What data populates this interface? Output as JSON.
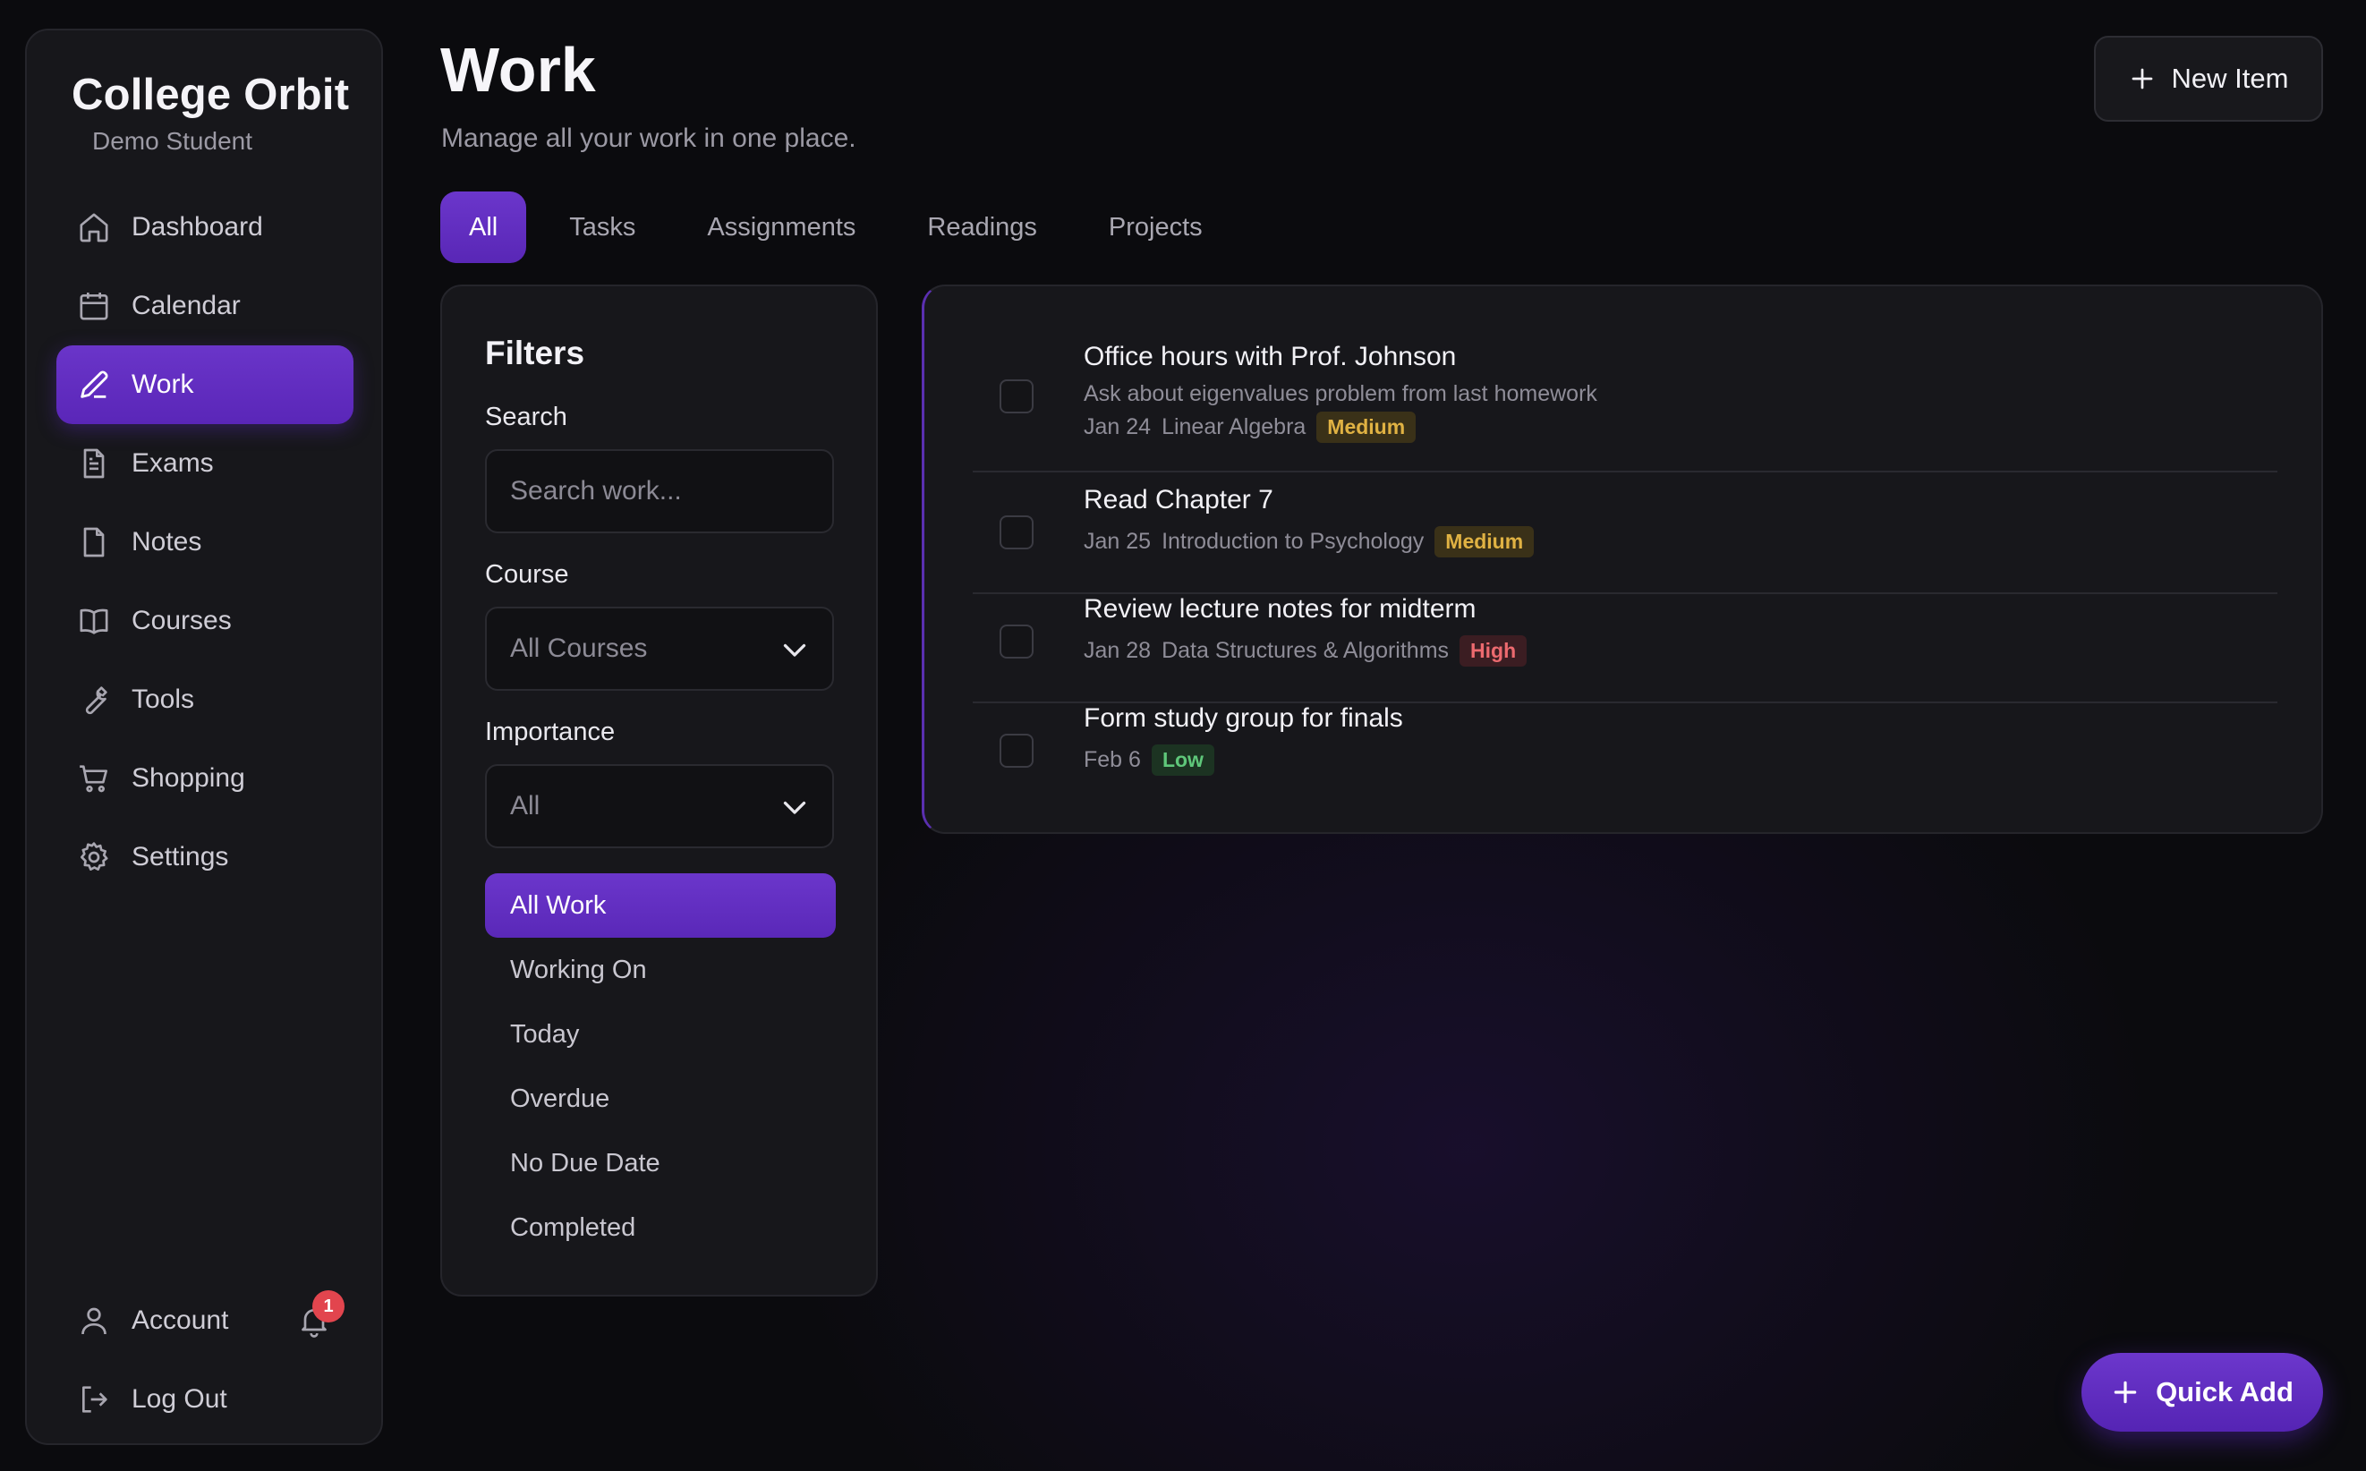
{
  "brand": {
    "title": "College Orbit",
    "subtitle": "Demo Student"
  },
  "nav": [
    {
      "label": "Dashboard",
      "icon": "home-icon"
    },
    {
      "label": "Calendar",
      "icon": "calendar-icon"
    },
    {
      "label": "Work",
      "icon": "pencil-icon",
      "active": true
    },
    {
      "label": "Exams",
      "icon": "document-icon"
    },
    {
      "label": "Notes",
      "icon": "file-icon"
    },
    {
      "label": "Courses",
      "icon": "book-icon"
    },
    {
      "label": "Tools",
      "icon": "wrench-icon"
    },
    {
      "label": "Shopping",
      "icon": "cart-icon"
    },
    {
      "label": "Settings",
      "icon": "gear-icon"
    }
  ],
  "account": {
    "label": "Account",
    "notifications": "1",
    "logout": "Log Out"
  },
  "header": {
    "title": "Work",
    "subtitle": "Manage all your work in one place.",
    "new_item": "New Item"
  },
  "tabs": [
    "All",
    "Tasks",
    "Assignments",
    "Readings",
    "Projects"
  ],
  "filters": {
    "title": "Filters",
    "search_label": "Search",
    "search_placeholder": "Search work...",
    "course_label": "Course",
    "course_value": "All Courses",
    "importance_label": "Importance",
    "importance_value": "All",
    "status": [
      "All Work",
      "Working On",
      "Today",
      "Overdue",
      "No Due Date",
      "Completed"
    ]
  },
  "work_items": [
    {
      "title": "Office hours with Prof. Johnson",
      "description": "Ask about eigenvalues problem from last homework",
      "date": "Jan 24",
      "course": "Linear Algebra",
      "priority": "Medium"
    },
    {
      "title": "Read Chapter 7",
      "date": "Jan 25",
      "course": "Introduction to Psychology",
      "priority": "Medium"
    },
    {
      "title": "Review lecture notes for midterm",
      "date": "Jan 28",
      "course": "Data Structures & Algorithms",
      "priority": "High"
    },
    {
      "title": "Form study group for finals",
      "date": "Feb 6",
      "course": "",
      "priority": "Low"
    }
  ],
  "quick_add": "Quick Add",
  "colors": {
    "accent": "#5f2ebf",
    "background": "#0b0b0e",
    "panel": "#17171b",
    "medium": "#e0b243",
    "high": "#ec6a6f",
    "low": "#5fc77a"
  }
}
